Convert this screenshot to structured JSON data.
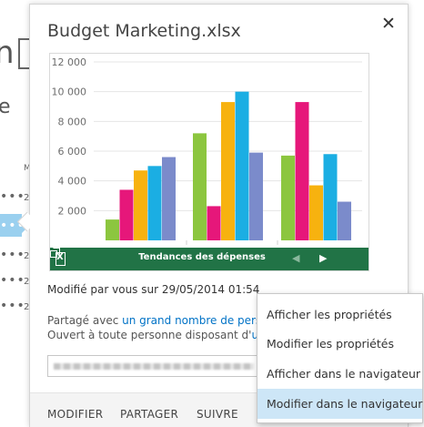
{
  "background": {
    "title_fragment": "n",
    "e_fragment": "e",
    "column_initial": "M",
    "row_dots": "•••",
    "row_initial": "2"
  },
  "callout": {
    "title": "Budget Marketing.xlsx",
    "close_icon": "close-icon",
    "preview": {
      "sheet_title": "Tendances des dépenses",
      "excel_icon": "excel-icon",
      "prev_icon": "triangle-left-icon",
      "next_icon": "triangle-right-icon",
      "popout_icon": "popout-icon",
      "accent": "#217346"
    },
    "modified_text": "Modifié par vous sur 29/05/2014 01:54",
    "shared_prefix": "Partagé avec ",
    "shared_link": "un grand nombre de perso",
    "open_prefix": "Ouvert à toute personne disposant d'",
    "open_link": "un",
    "footer": {
      "edit": "MODIFIER",
      "share": "PARTAGER",
      "follow": "SUIVRE"
    }
  },
  "context_menu": {
    "items": [
      {
        "label": "Afficher les propriétés"
      },
      {
        "label": "Modifier les propriétés"
      },
      {
        "label": "Afficher dans le navigateur"
      },
      {
        "label": "Modifier dans le navigateur"
      }
    ],
    "hover_index": 3,
    "hover_color": "#cde6f7"
  },
  "chart_data": {
    "type": "bar",
    "title": "",
    "xlabel": "",
    "ylabel": "",
    "ylim": [
      0,
      12000
    ],
    "yticks": [
      "12 000",
      "10 000",
      "8 000",
      "6 000",
      "4 000",
      "2 000"
    ],
    "categories": [
      "",
      "",
      ""
    ],
    "grid": true,
    "series": [
      {
        "color": "#8cc63f",
        "values": [
          1400,
          7200,
          5700
        ]
      },
      {
        "color": "#e6177a",
        "values": [
          3400,
          2300,
          9300
        ]
      },
      {
        "color": "#f7b20f",
        "values": [
          4700,
          9300,
          3700
        ]
      },
      {
        "color": "#1baee3",
        "values": [
          5000,
          10000,
          5800
        ]
      },
      {
        "color": "#7b8bcb",
        "values": [
          5600,
          5900,
          2600
        ]
      }
    ]
  }
}
